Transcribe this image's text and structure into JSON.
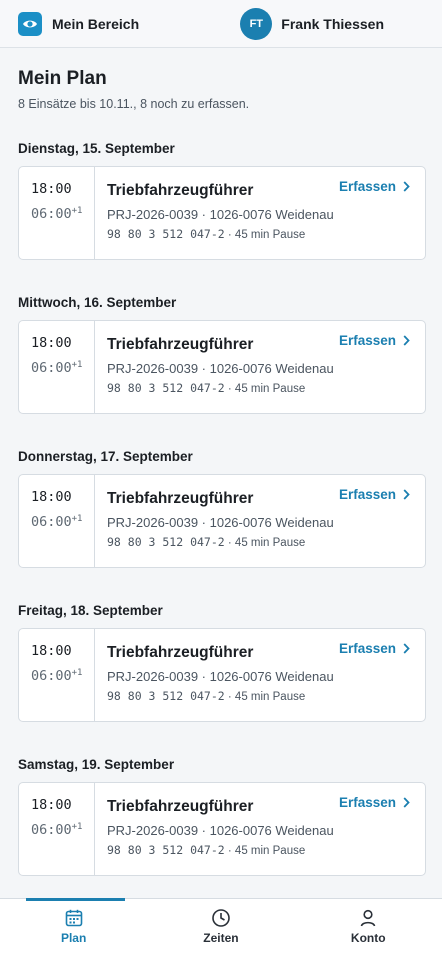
{
  "header": {
    "app_icon": "eye-icon",
    "app_label": "Mein Bereich",
    "user_initials": "FT",
    "user_name": "Frank Thiessen"
  },
  "main": {
    "title": "Mein Plan",
    "subtitle": "8 Einsätze bis 10.11., 8 noch zu erfassen."
  },
  "days": [
    {
      "date": "Dienstag, 15. September",
      "start": "18:00",
      "end": "06:00",
      "end_suffix": "+1",
      "role": "Triebfahrzeugführer",
      "project": "PRJ-2026-0039 · 1026-0076 Weidenau",
      "vehicle": "98 80 3 512 047-2",
      "pause": " · 45 min Pause",
      "action": "Erfassen"
    },
    {
      "date": "Mittwoch, 16. September",
      "start": "18:00",
      "end": "06:00",
      "end_suffix": "+1",
      "role": "Triebfahrzeugführer",
      "project": "PRJ-2026-0039 · 1026-0076 Weidenau",
      "vehicle": "98 80 3 512 047-2",
      "pause": " · 45 min Pause",
      "action": "Erfassen"
    },
    {
      "date": "Donnerstag, 17. September",
      "start": "18:00",
      "end": "06:00",
      "end_suffix": "+1",
      "role": "Triebfahrzeugführer",
      "project": "PRJ-2026-0039 · 1026-0076 Weidenau",
      "vehicle": "98 80 3 512 047-2",
      "pause": " · 45 min Pause",
      "action": "Erfassen"
    },
    {
      "date": "Freitag, 18. September",
      "start": "18:00",
      "end": "06:00",
      "end_suffix": "+1",
      "role": "Triebfahrzeugführer",
      "project": "PRJ-2026-0039 · 1026-0076 Weidenau",
      "vehicle": "98 80 3 512 047-2",
      "pause": " · 45 min Pause",
      "action": "Erfassen"
    },
    {
      "date": "Samstag, 19. September",
      "start": "18:00",
      "end": "06:00",
      "end_suffix": "+1",
      "role": "Triebfahrzeugführer",
      "project": "PRJ-2026-0039 · 1026-0076 Weidenau",
      "vehicle": "98 80 3 512 047-2",
      "pause": " · 45 min Pause",
      "action": "Erfassen"
    }
  ],
  "tabs": [
    {
      "label": "Plan",
      "icon": "calendar-icon",
      "active": true
    },
    {
      "label": "Zeiten",
      "icon": "clock-icon",
      "active": false
    },
    {
      "label": "Konto",
      "icon": "person-icon",
      "active": false
    }
  ],
  "colors": {
    "accent": "#1b7fb0",
    "brand_icon_bg": "#1b8fc6",
    "page_bg": "#f4f6f8"
  }
}
